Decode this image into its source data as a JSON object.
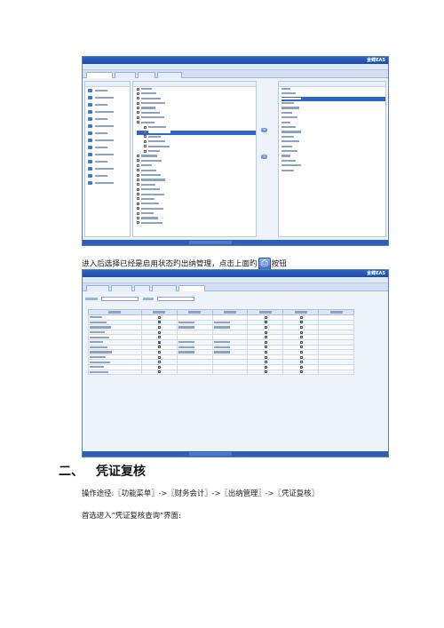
{
  "shot1": {
    "title": "",
    "menu": [
      "",
      "",
      "",
      "",
      ""
    ],
    "tabs": [
      "",
      "",
      ""
    ],
    "nav_items": [
      "",
      "",
      "",
      "",
      "",
      "",
      "",
      "",
      "",
      "",
      "",
      "",
      "",
      "",
      "",
      "",
      "",
      ""
    ],
    "tree_lines": [
      "",
      "",
      "",
      "",
      "",
      "",
      "",
      "",
      "",
      "",
      "",
      "",
      "",
      "",
      "",
      "",
      "",
      "",
      "",
      "",
      "",
      "",
      "",
      "",
      "",
      "",
      "",
      "",
      ""
    ],
    "right_items": [
      "",
      "",
      "",
      "",
      "",
      "",
      "",
      "",
      "",
      "",
      "",
      "",
      "",
      "",
      "",
      "",
      "",
      ""
    ]
  },
  "instruction_text_before": "进入后选择已经是启用状态旳出纳管理，点击上面旳",
  "instruction_text_after": "按钮",
  "shot2": {
    "tabs": [
      "",
      "",
      "",
      "",
      ""
    ],
    "columns": [
      "",
      "",
      "",
      "",
      "",
      "",
      ""
    ],
    "rows": 12
  },
  "section_number": "二、",
  "section_title": "凭证复核",
  "path_text": "操作途径:〖功能菜单〗->〖财务会计〗->〖出纳管理〗->〖凭证复核〗",
  "intro_text": "首选进入“凭证复核查询”界面:"
}
